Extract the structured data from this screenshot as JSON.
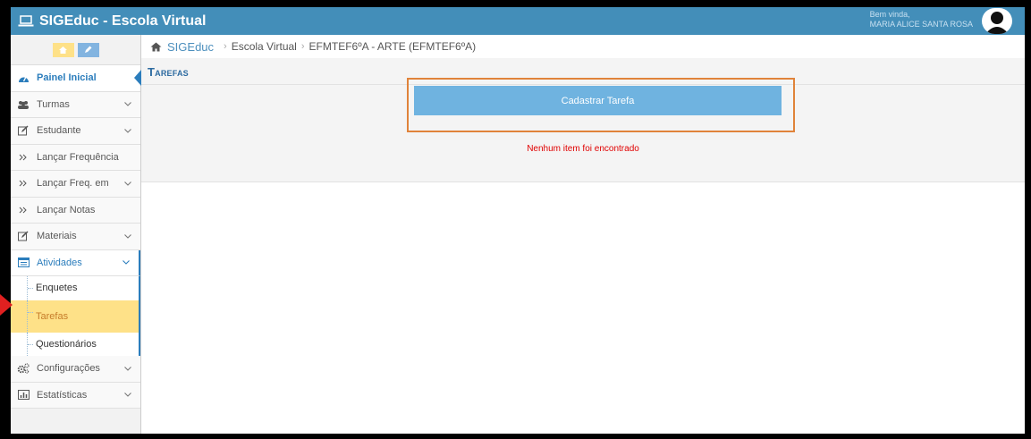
{
  "app": {
    "title": "SIGEduc - Escola Virtual",
    "greeting": "Bem vinda,",
    "user_name": "MARIA ALICE SANTA ROSA"
  },
  "sidebar": {
    "items": [
      {
        "label": "Painel Inicial",
        "icon": "dashboard-icon"
      },
      {
        "label": "Turmas",
        "icon": "users-icon"
      },
      {
        "label": "Estudante",
        "icon": "edit-icon"
      },
      {
        "label": "Lançar Frequência",
        "icon": "double-chevron-icon"
      },
      {
        "label": "Lançar Freq. em",
        "icon": "double-chevron-icon"
      },
      {
        "label": "Lançar Notas",
        "icon": "double-chevron-icon"
      },
      {
        "label": "Materiais",
        "icon": "edit-icon"
      },
      {
        "label": "Atividades",
        "icon": "list-icon"
      },
      {
        "label": "Configurações",
        "icon": "gears-icon"
      },
      {
        "label": "Estatísticas",
        "icon": "bar-chart-icon"
      }
    ],
    "submenu": [
      {
        "label": "Enquetes"
      },
      {
        "label": "Tarefas"
      },
      {
        "label": "Questionários"
      }
    ]
  },
  "breadcrumb": {
    "root": "SIGEduc",
    "items": [
      "Escola Virtual",
      "EFMTEF6ºA - ARTE (EFMTEF6ºA)"
    ]
  },
  "page": {
    "title": "Tarefas",
    "add_button": "Cadastrar Tarefa",
    "empty_message": "Nenhum item foi encontrado"
  },
  "colors": {
    "topbar": "#438eb9",
    "accent": "#2b7dbc",
    "button": "#6fb3e0",
    "highlight": "#fee188",
    "annotation": "#e0833a",
    "error": "#e00000"
  }
}
